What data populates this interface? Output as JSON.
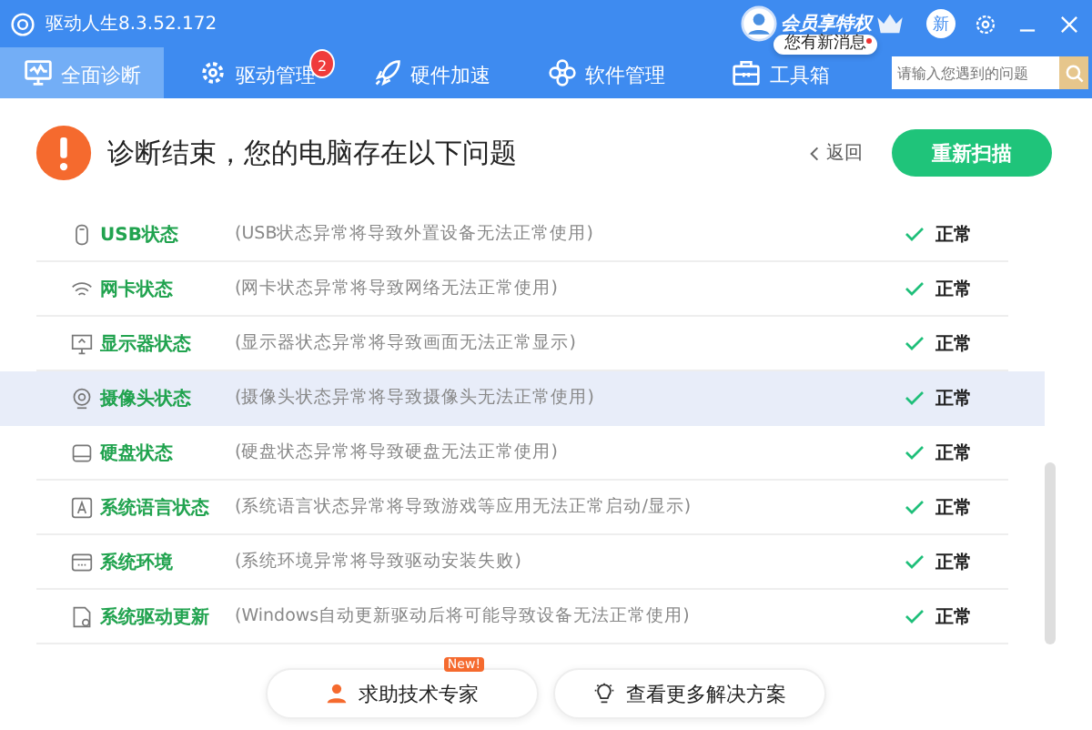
{
  "window": {
    "title": "驱动人生8.3.52.172",
    "member_label": "会员享特权",
    "news_badge": "新",
    "message_tip": "您有新消息",
    "message_unread": true
  },
  "tabs": [
    {
      "label": "全面诊断",
      "kind": "monitor",
      "selected": true
    },
    {
      "label": "驱动管理",
      "kind": "gear",
      "selected": false,
      "badge": "2"
    },
    {
      "label": "硬件加速",
      "kind": "rocket",
      "selected": false
    },
    {
      "label": "软件管理",
      "kind": "flower",
      "selected": false
    },
    {
      "label": "工具箱",
      "kind": "toolbox",
      "selected": false
    }
  ],
  "search": {
    "placeholder": "请输入您遇到的问题"
  },
  "header": {
    "title": "诊断结束，您的电脑存在以下问题",
    "back": "返回",
    "rescan": "重新扫描"
  },
  "rows": [
    {
      "kind": "usb",
      "name": "USB状态",
      "desc": "(USB状态异常将导致外置设备无法正常使用)",
      "status": "正常",
      "selected": false
    },
    {
      "kind": "wifi",
      "name": "网卡状态",
      "desc": "(网卡状态异常将导致网络无法正常使用)",
      "status": "正常",
      "selected": false
    },
    {
      "kind": "monitor",
      "name": "显示器状态",
      "desc": "(显示器状态异常将导致画面无法正常显示)",
      "status": "正常",
      "selected": false
    },
    {
      "kind": "camera",
      "name": "摄像头状态",
      "desc": "(摄像头状态异常将导致摄像头无法正常使用)",
      "status": "正常",
      "selected": true
    },
    {
      "kind": "disk",
      "name": "硬盘状态",
      "desc": "(硬盘状态异常将导致硬盘无法正常使用)",
      "status": "正常",
      "selected": false
    },
    {
      "kind": "lang",
      "name": "系统语言状态",
      "desc": "(系统语言状态异常将导致游戏等应用无法正常启动/显示)",
      "status": "正常",
      "selected": false
    },
    {
      "kind": "window",
      "name": "系统环境",
      "desc": "(系统环境异常将导致驱动安装失败)",
      "status": "正常",
      "selected": false
    },
    {
      "kind": "file",
      "name": "系统驱动更新",
      "desc": "(Windows自动更新驱动后将可能导致设备无法正常使用)",
      "status": "正常",
      "selected": false
    }
  ],
  "footer": [
    {
      "label": "求助技术专家",
      "kind": "person",
      "badge": "New!"
    },
    {
      "label": "查看更多解决方案",
      "kind": "bulb"
    }
  ]
}
